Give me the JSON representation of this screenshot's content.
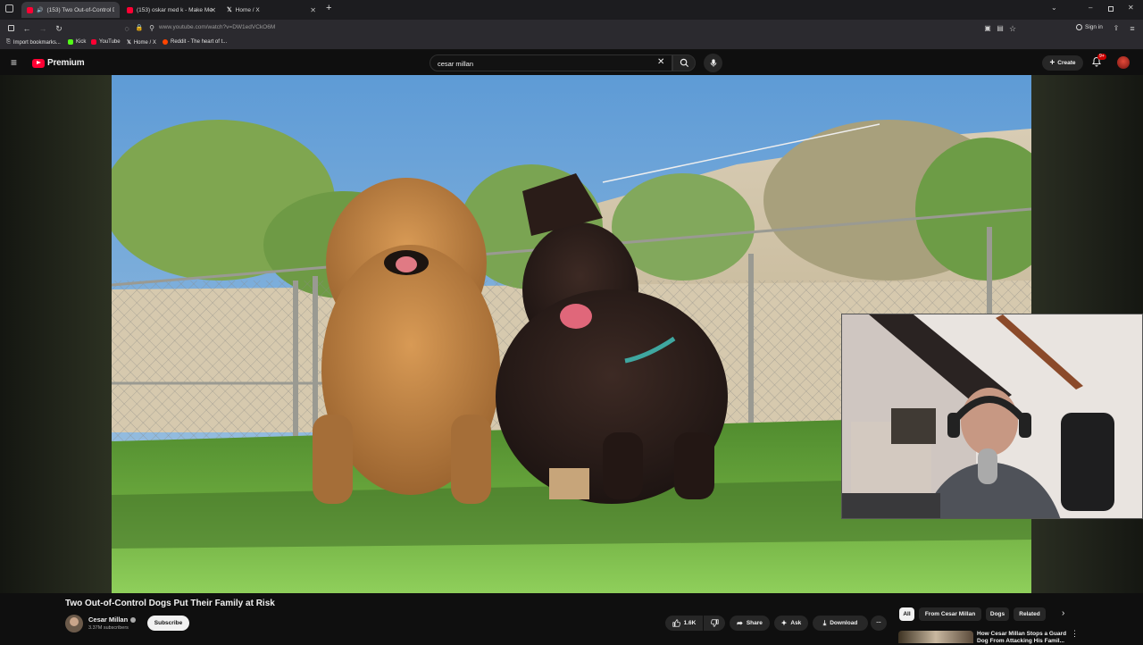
{
  "browser": {
    "tabs": [
      {
        "title": "(153) Two Out-of-Control D",
        "active": true
      },
      {
        "title": "(153) oskar med k - Make Me F",
        "active": false
      },
      {
        "title": "Home / X",
        "active": false
      }
    ],
    "new_tab": "+",
    "url": "www.youtube.com/watch?v=DW1edVCkO6M",
    "sign_in": "Sign in",
    "bookmarks": [
      "Import bookmarks...",
      "Kick",
      "YouTube",
      "Home / X",
      "Reddit - The heart of t..."
    ]
  },
  "youtube": {
    "logo": "Premium",
    "search_value": "cesar millan",
    "create_label": "Create",
    "notif_count": "9+"
  },
  "video": {
    "title": "Two Out-of-Control Dogs Put Their Family at Risk",
    "channel": "Cesar Millan",
    "subscribers": "3.37M subscribers",
    "subscribe_label": "Subscribe",
    "likes": "1.6K",
    "share_label": "Share",
    "ask_label": "Ask",
    "download_label": "Download",
    "more": "..."
  },
  "chips": [
    "All",
    "From Cesar Millan",
    "Dogs",
    "Related"
  ],
  "recommended": {
    "title": "How Cesar Millan Stops a Guard Dog From Attacking His Famil..."
  },
  "colors": {
    "accent": "#ff0033",
    "bg": "#0f0f0f"
  }
}
